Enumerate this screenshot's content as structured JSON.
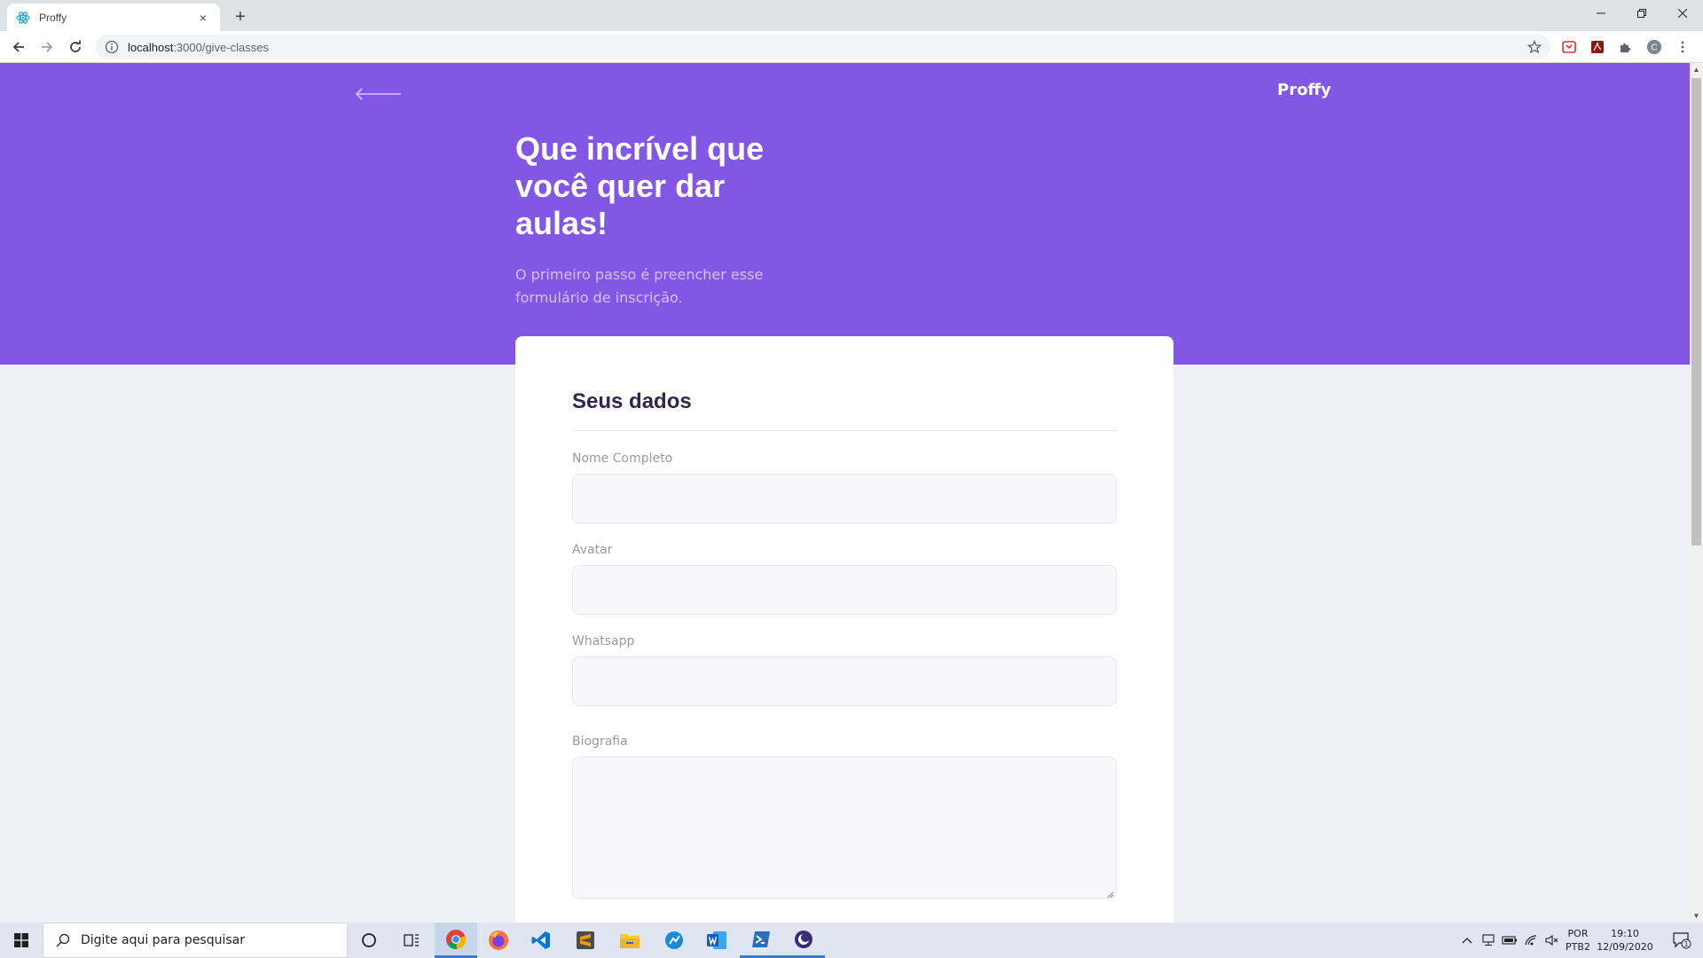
{
  "browser": {
    "tab_title": "Proffy",
    "tab_close": "×",
    "new_tab": "+",
    "url_host": "localhost",
    "url_path": ":3000/give-classes",
    "profile_initial": "C"
  },
  "page": {
    "brand": "Proffy",
    "hero_title": "Que incrível que você quer dar aulas!",
    "hero_description": "O primeiro passo é preencher esse formulário de inscrição.",
    "form": {
      "section_title": "Seus dados",
      "fields": [
        {
          "label": "Nome Completo",
          "value": ""
        },
        {
          "label": "Avatar",
          "value": ""
        },
        {
          "label": "Whatsapp",
          "value": ""
        },
        {
          "label": "Biografia",
          "value": ""
        }
      ]
    }
  },
  "taskbar": {
    "search_placeholder": "Digite aqui para pesquisar",
    "language_top": "POR",
    "language_bottom": "PTB2",
    "time": "19:10",
    "date": "12/09/2020",
    "notification_count": "1"
  },
  "colors": {
    "brand_purple": "#8257e5",
    "page_background": "#f0f0f7",
    "title_dark": "#32264d",
    "hero_text_light": "#d4c2ff"
  },
  "icons": {
    "tab_favicon": "react-atom-icon",
    "back": "arrow-left-icon",
    "forward": "arrow-right-icon",
    "reload": "reload-icon",
    "site_info": "info-icon",
    "bookmark": "star-icon"
  }
}
